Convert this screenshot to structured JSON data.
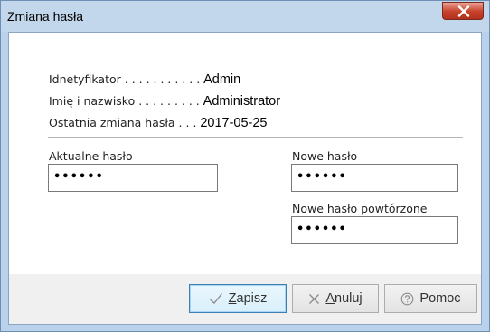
{
  "window": {
    "title": "Zmiana hasła"
  },
  "info": {
    "identifier_label": "Idnetyfikator . . . . . . . . . . .",
    "identifier_value": "Admin",
    "name_label": "Imię i nazwisko . . . . . . . . .",
    "name_value": "Administrator",
    "last_change_label": "Ostatnia zmiana hasła . . .",
    "last_change_value": "2017-05-25"
  },
  "form": {
    "current_password_label": "Aktualne hasło",
    "current_password_value": "••••••",
    "new_password_label": "Nowe hasło",
    "new_password_value": "••••••",
    "repeat_password_label": "Nowe hasło powtórzone",
    "repeat_password_value": "••••••"
  },
  "buttons": {
    "save_label_first": "Z",
    "save_label_rest": "apisz",
    "cancel_label_first": "A",
    "cancel_label_rest": "nuluj",
    "help_label": "Pomoc"
  },
  "icons": {
    "close": "close-icon",
    "save": "checkmark-icon",
    "cancel": "x-icon",
    "help": "question-circle-icon"
  }
}
